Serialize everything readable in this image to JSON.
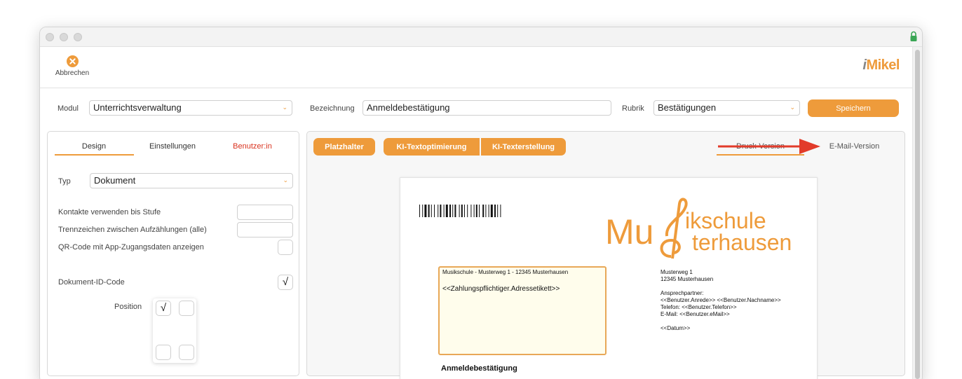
{
  "toolbar": {
    "cancel_label": "Abbrechen",
    "logo_text": "Mikel",
    "logo_i": "i"
  },
  "colors": {
    "accent": "#ee9b3b",
    "error_tab": "#d9331f",
    "arrow": "#e23b2a"
  },
  "form": {
    "modul_label": "Modul",
    "modul_value": "Unterrichtsverwaltung",
    "bezeichnung_label": "Bezeichnung",
    "bezeichnung_value": "Anmeldebestätigung",
    "rubrik_label": "Rubrik",
    "rubrik_value": "Bestätigungen",
    "save_label": "Speichern"
  },
  "left": {
    "tabs": [
      {
        "label": "Design",
        "active": true
      },
      {
        "label": "Einstellungen",
        "active": false
      },
      {
        "label": "Benutzer:in",
        "active": false
      }
    ],
    "typ_label": "Typ",
    "typ_value": "Dokument",
    "kontakte_label": "Kontakte verwenden bis Stufe",
    "kontakte_value": "",
    "trennzeichen_label": "Trennzeichen zwischen Aufzählungen (alle)",
    "trennzeichen_value": "",
    "qr_label": "QR-Code mit App-Zugangsdaten anzeigen",
    "qr_checked": "",
    "docid_label": "Dokument-ID-Code",
    "docid_checked": "√",
    "position_label": "Position",
    "position_checks": [
      "√",
      "",
      "",
      ""
    ]
  },
  "right": {
    "buttons": {
      "platzhalter": "Platzhalter",
      "ki_opt": "KI-Textoptimierung",
      "ki_erst": "KI-Texterstellung"
    },
    "tabs": {
      "druck": "Druck-Version",
      "email": "E-Mail-Version"
    },
    "doc": {
      "logo_line1": "ikschule",
      "logo_line2": "terhausen",
      "logo_mu": "Mu",
      "sender": "Musikschule - Musterweg 1 - 12345 Musterhausen",
      "address_label": "<<Zahlungspflichtiger.Adressetikett>>",
      "info": [
        "Musterweg 1",
        "12345 Musterhausen",
        "",
        "Ansprechpartner:",
        "<<Benutzer.Anrede>> <<Benutzer.Nachname>>",
        "Telefon: <<Benutzer.Telefon>>",
        "E-Mail: <<Benutzer.eMail>>",
        "",
        "<<Datum>>"
      ],
      "title": "Anmeldebestätigung"
    }
  }
}
